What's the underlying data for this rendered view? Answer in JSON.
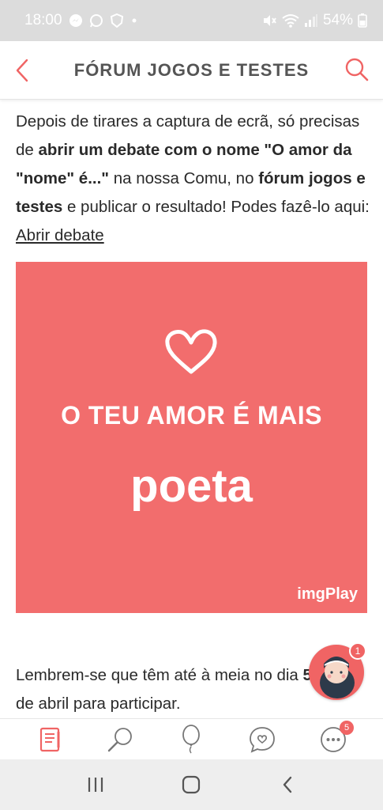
{
  "status_bar": {
    "time": "18:00",
    "battery": "54%",
    "icons": [
      "messenger-icon",
      "whatsapp-icon",
      "shield-app-icon",
      "dot-icon",
      "mute-icon",
      "wifi-icon",
      "signal-icon",
      "battery-icon"
    ]
  },
  "nav": {
    "title": "FÓRUM JOGOS E TESTES",
    "back_icon": "chevron-left-icon",
    "search_icon": "search-icon"
  },
  "post": {
    "p1_a": "Depois de tirares a captura de ecrã, só precisas de ",
    "p1_b": "abrir um debate com o nome \"O amor da \"nome\" é...\"",
    "p1_c": " na nossa Comu, no ",
    "p1_d": "fórum jogos e testes",
    "p1_e": " e publicar o resultado! Podes fazê-lo aqui: ",
    "p1_link": "Abrir debate",
    "banner_line1": "O TEU AMOR É MAIS",
    "banner_line2": "poeta",
    "banner_watermark": "imgPlay",
    "p2_a": "Lembrem-se que têm até à meia no dia ",
    "p2_b": "5",
    "p2_c": " de abril para participar."
  },
  "floating_avatar": {
    "badge": "1"
  },
  "tab_bar": {
    "tabs": [
      {
        "name": "notebook-icon"
      },
      {
        "name": "search-icon"
      },
      {
        "name": "balloon-icon"
      },
      {
        "name": "chat-heart-icon"
      },
      {
        "name": "more-icon",
        "badge": "5"
      }
    ]
  },
  "colors": {
    "accent": "#f26d6d",
    "banner": "#f26d6d",
    "status_bar": "#dcdcdc",
    "text": "#2a2a2a"
  }
}
